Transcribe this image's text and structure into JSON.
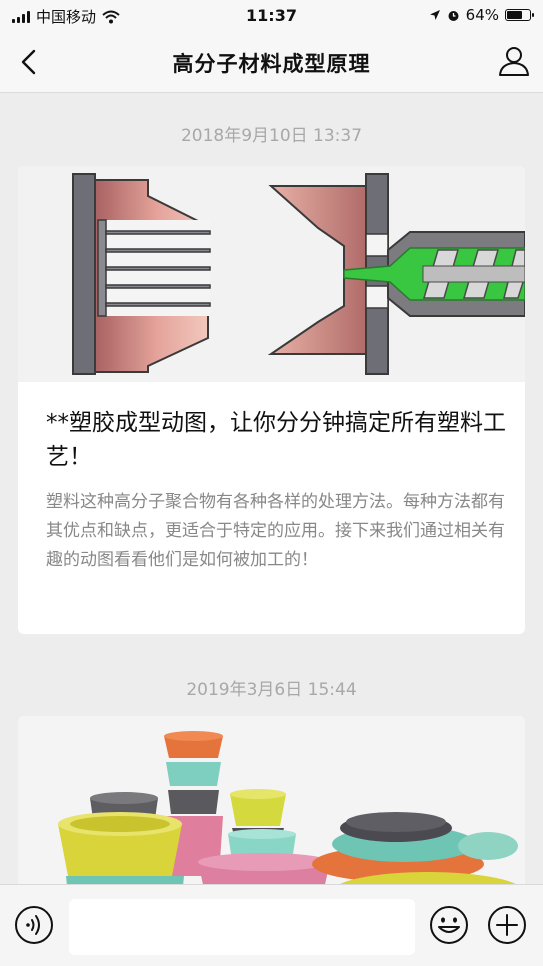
{
  "status_bar": {
    "carrier": "中国移动",
    "time": "11:37",
    "battery": "64%",
    "battery_level": 0.64
  },
  "nav": {
    "title": "高分子材料成型原理"
  },
  "messages": [
    {
      "timestamp": "2018年9月10日 13:37",
      "title": "**塑胶成型动图，让你分分钟搞定所有塑料工艺！",
      "description": "塑料这种高分子聚合物有各种各样的处理方法。每种方法都有其优点和缺点，更适合于特定的应用。接下来我们通过相关有趣的动图看看他们是如何被加工的！"
    },
    {
      "timestamp": "2019年3月6日 15:44"
    }
  ],
  "colors": {
    "background": "#ededed",
    "mold_pink": "#d98c86",
    "mold_gray": "#6e6e76",
    "plastic_green": "#39c640"
  },
  "icons": {
    "back": "chevron-left-icon",
    "user": "user-icon",
    "voice": "voice-icon",
    "emoji": "emoji-icon",
    "plus": "plus-icon"
  }
}
